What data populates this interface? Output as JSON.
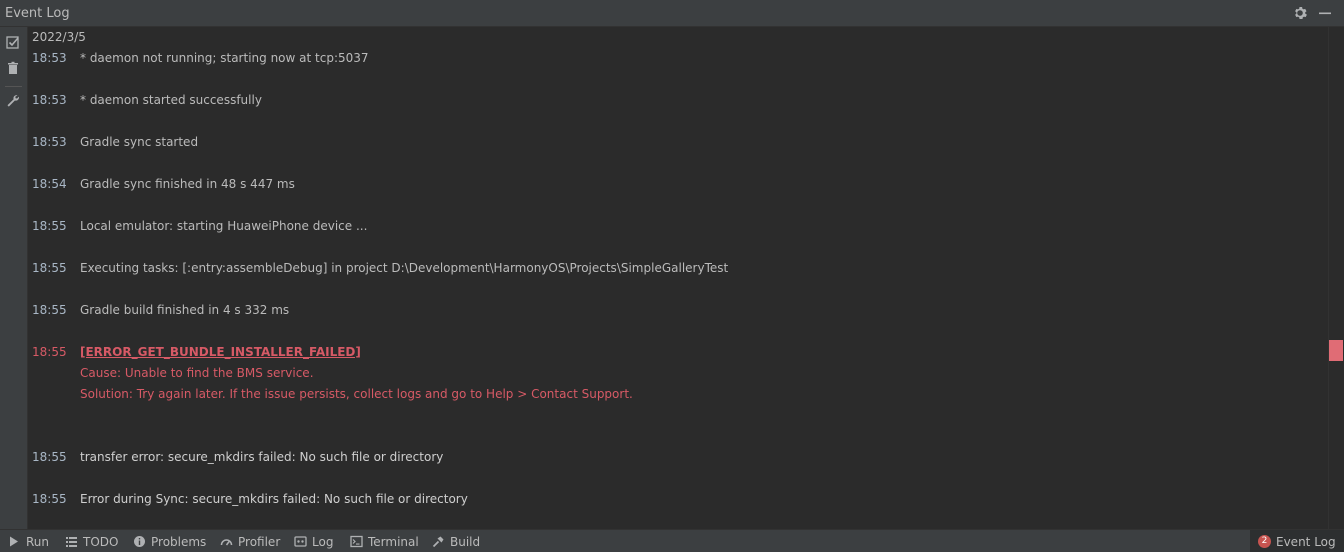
{
  "window": {
    "title": "Event Log"
  },
  "log": {
    "date": "2022/3/5",
    "entries": [
      {
        "time": "18:53",
        "lines": [
          "* daemon not running; starting now at tcp:5037"
        ],
        "level": "normal"
      },
      {
        "time": "18:53",
        "lines": [
          "* daemon started successfully"
        ],
        "level": "normal"
      },
      {
        "time": "18:53",
        "lines": [
          "Gradle sync started"
        ],
        "level": "normal"
      },
      {
        "time": "18:54",
        "lines": [
          "Gradle sync finished in 48 s 447 ms"
        ],
        "level": "normal"
      },
      {
        "time": "18:55",
        "lines": [
          "Local emulator: starting HuaweiPhone device ..."
        ],
        "level": "normal"
      },
      {
        "time": "18:55",
        "lines": [
          "Executing tasks: [:entry:assembleDebug] in project D:\\Development\\HarmonyOS\\Projects\\SimpleGalleryTest"
        ],
        "level": "normal"
      },
      {
        "time": "18:55",
        "lines": [
          "Gradle build finished in 4 s 332 ms"
        ],
        "level": "normal"
      },
      {
        "time": "18:55",
        "lines": [
          "[ERROR_GET_BUNDLE_INSTALLER_FAILED]",
          "Cause: Unable to find the BMS service.",
          "Solution: Try again later. If the issue persists, collect logs and go to Help > Contact Support."
        ],
        "level": "error"
      },
      {
        "time": "18:55",
        "lines": [
          "transfer error: secure_mkdirs failed: No such file or directory"
        ],
        "level": "normal"
      },
      {
        "time": "18:55",
        "lines": [
          "Error during Sync: secure_mkdirs failed: No such file or directory"
        ],
        "level": "normal"
      }
    ]
  },
  "statusbar": {
    "run": "Run",
    "todo": "TODO",
    "problems": "Problems",
    "profiler": "Profiler",
    "log": "Log",
    "terminal": "Terminal",
    "build": "Build",
    "event_log": "Event Log",
    "event_log_count": "2"
  },
  "colors": {
    "error": "#d75a66",
    "background": "#2b2b2b",
    "panel": "#3c3f41"
  }
}
